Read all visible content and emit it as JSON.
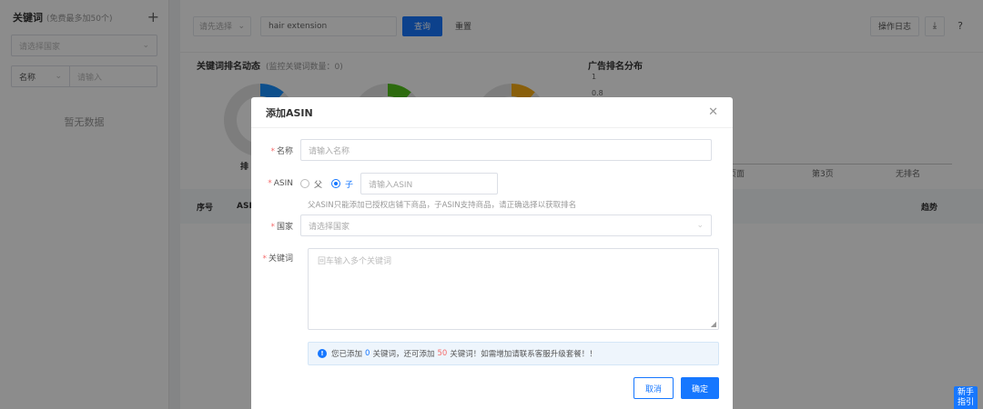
{
  "sidebar": {
    "title": "关键词",
    "subtitle": "(免费最多加50个)",
    "country_placeholder": "请选择国家",
    "filter_field": "名称",
    "filter_placeholder": "请输入",
    "empty_text": "暂无数据"
  },
  "toolbar": {
    "site_select": "请先选择",
    "keyword_value": "hair extension",
    "query_label": "查询",
    "reset_label": "重置",
    "log_label": "操作日志"
  },
  "dashboard": {
    "rank_dynamics_title": "关键词排名动态",
    "rank_dynamics_sub": "(监控关键词数量：0)",
    "ad_rank_title": "广告排名分布",
    "rank_label_partial": "排",
    "y_ticks": [
      "1",
      "0.8"
    ],
    "x_ticks_visible": [
      "页面",
      "第3页",
      "无排名"
    ],
    "donut_colors": [
      "#1890ff",
      "#52c41a",
      "#faad14"
    ]
  },
  "table": {
    "headers_visible": [
      "序号",
      "ASI",
      "趋势"
    ]
  },
  "modal": {
    "title": "添加ASIN",
    "name_label": "名称",
    "name_placeholder": "请输入名称",
    "asin_label": "ASIN",
    "radio_parent": "父",
    "radio_child": "子",
    "radio_selected": "子",
    "asin_placeholder": "请输入ASIN",
    "asin_hint": "父ASIN只能添加已授权店铺下商品，子ASIN支持商品，请正确选择以获取排名",
    "country_label": "国家",
    "country_placeholder": "请选择国家",
    "keyword_label": "关键词",
    "keyword_placeholder": "回车输入多个关键词",
    "notice_prefix": "您已添加",
    "notice_added": "0",
    "notice_mid": "关键词，还可添加",
    "notice_remaining": "50",
    "notice_suffix": "关键词！如需增加请联系客服升级套餐！！",
    "cancel_label": "取消",
    "ok_label": "确定"
  },
  "guide": {
    "label_line1": "新手",
    "label_line2": "指引"
  }
}
